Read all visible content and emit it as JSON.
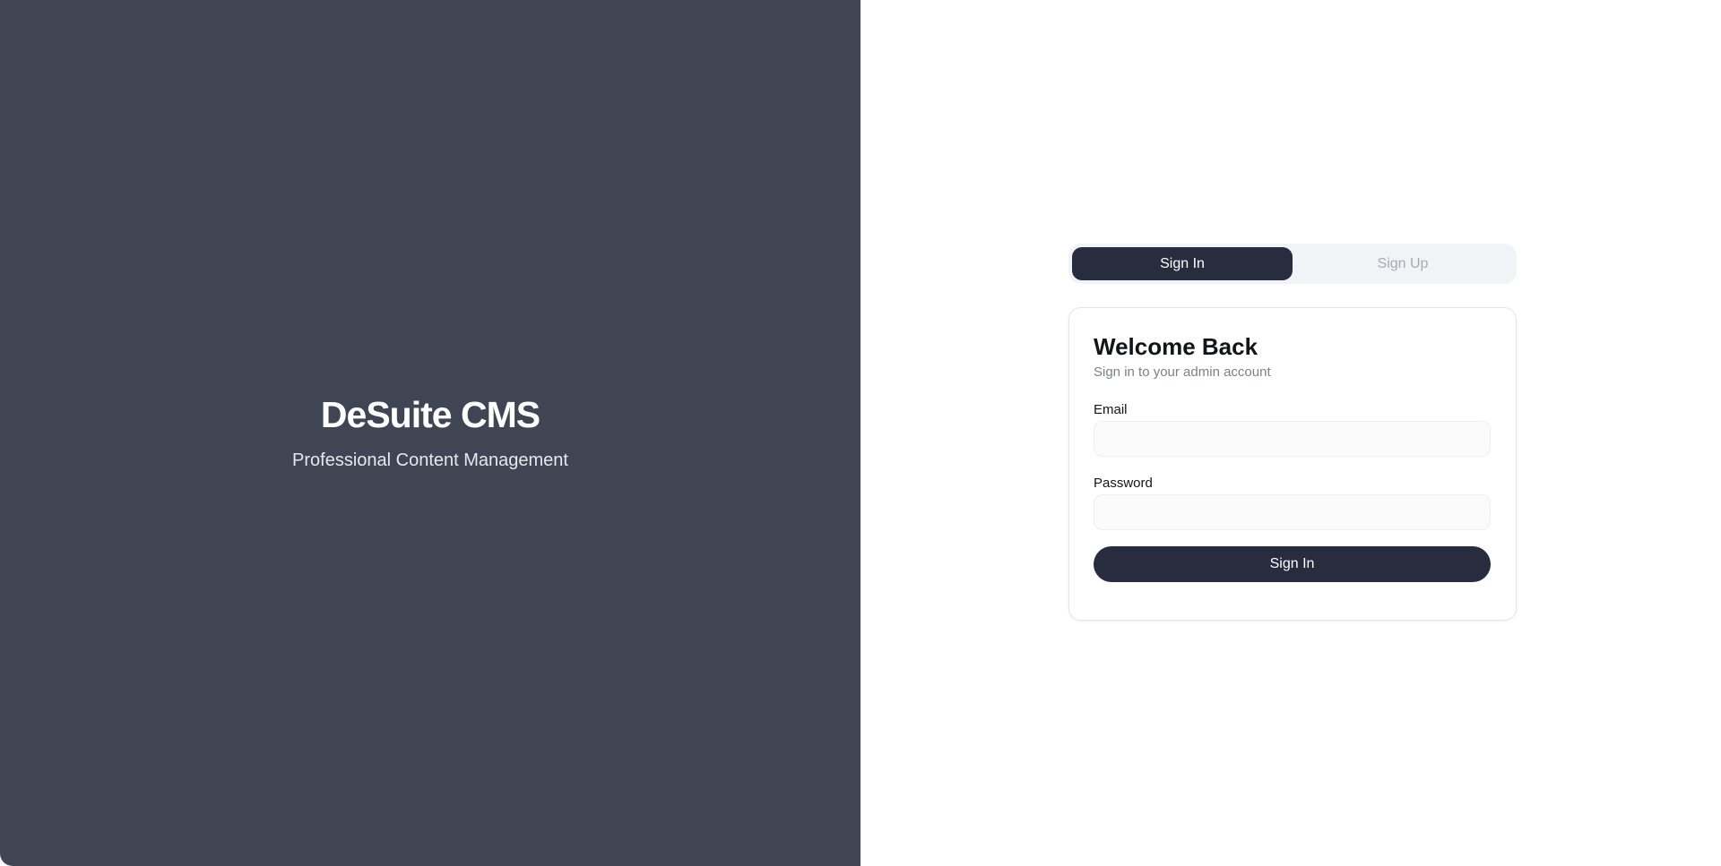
{
  "brand": {
    "title": "DeSuite CMS",
    "subtitle": "Professional Content Management"
  },
  "tabs": [
    {
      "label": "Sign In",
      "active": true
    },
    {
      "label": "Sign Up",
      "active": false
    }
  ],
  "card": {
    "title": "Welcome Back",
    "subtitle": "Sign in to your admin account"
  },
  "form": {
    "email": {
      "label": "Email",
      "value": "",
      "placeholder": ""
    },
    "password": {
      "label": "Password",
      "value": "",
      "placeholder": ""
    },
    "submit_label": "Sign In"
  },
  "colors": {
    "brand_panel_bg": "#3f4553",
    "primary_dark": "#272d3f",
    "tab_bg": "#f1f3f6",
    "muted_text": "#7c818a"
  }
}
